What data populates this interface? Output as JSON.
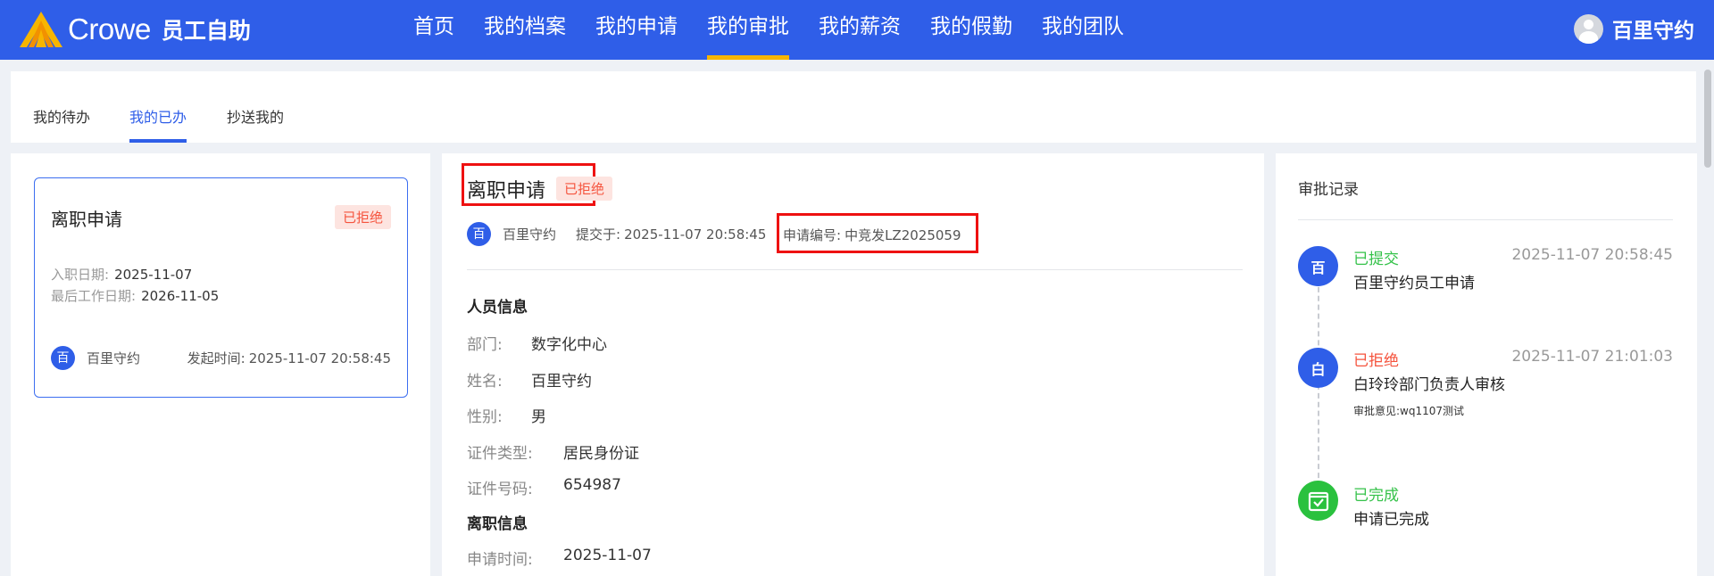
{
  "header": {
    "brand": "Crowe",
    "app_name": "员工自助",
    "nav": [
      "首页",
      "我的档案",
      "我的申请",
      "我的审批",
      "我的薪资",
      "我的假勤",
      "我的团队"
    ],
    "active_nav": "我的审批",
    "user_name": "百里守约",
    "accent_color": "#2f5ee8",
    "active_underline_color": "#f7b500"
  },
  "tabs": {
    "items": [
      "我的待办",
      "我的已办",
      "抄送我的"
    ],
    "active": "我的已办"
  },
  "list_card": {
    "title": "离职申请",
    "status": "已拒绝",
    "entry_date_label": "入职日期:",
    "entry_date": "2025-11-07",
    "last_work_label": "最后工作日期:",
    "last_work_date": "2026-11-05",
    "avatar_char": "百",
    "applicant": "百里守约",
    "start_time_label": "发起时间:",
    "start_time": "2025-11-07 20:58:45"
  },
  "detail": {
    "title": "离职申请",
    "status": "已拒绝",
    "avatar_char": "百",
    "applicant": "百里守约",
    "submitted_label": "提交于:",
    "submitted_at": "2025-11-07 20:58:45",
    "app_no_label": "申请编号:",
    "app_no": "中竞发LZ2025059",
    "personnel_section": "人员信息",
    "fields": [
      {
        "label": "部门:",
        "value": "数字化中心"
      },
      {
        "label": "姓名:",
        "value": "百里守约"
      },
      {
        "label": "性别:",
        "value": "男"
      },
      {
        "label": "证件类型:",
        "value": "居民身份证"
      },
      {
        "label": "证件号码:",
        "value": "654987"
      }
    ],
    "resign_section": "离职信息",
    "resign_fields": [
      {
        "label": "申请时间:",
        "value": "2025-11-07"
      }
    ]
  },
  "records": {
    "title": "审批记录",
    "items": [
      {
        "icon_char": "百",
        "status": "已提交",
        "status_color": "#35c24a",
        "icon_color": "#2f5ee8",
        "time": "2025-11-07 20:58:45",
        "desc": "百里守约员工申请"
      },
      {
        "icon_char": "白",
        "status": "已拒绝",
        "status_color": "#f5533d",
        "icon_color": "#2f5ee8",
        "time": "2025-11-07 21:01:03",
        "desc": "白玲玲部门负责人审核",
        "note_label": "审批意见:",
        "note": "wq1107测试"
      },
      {
        "icon_char": "",
        "icon": "check-calendar-icon",
        "status": "已完成",
        "status_color": "#35c24a",
        "icon_color": "#2ac13e",
        "time": "",
        "desc": "申请已完成"
      }
    ]
  }
}
